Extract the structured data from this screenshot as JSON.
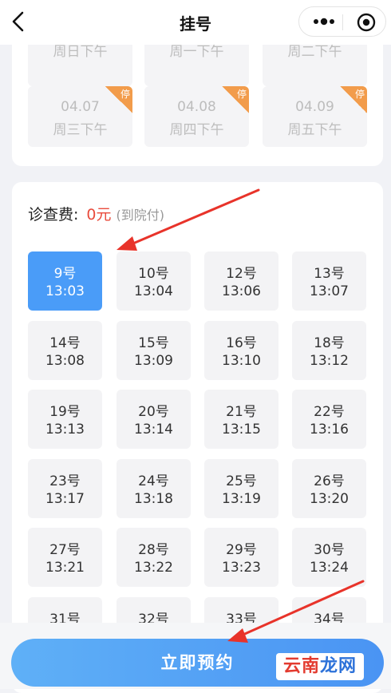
{
  "header": {
    "title": "挂号"
  },
  "dates": [
    {
      "date": "",
      "label": "周日下午",
      "stopped": false
    },
    {
      "date": "",
      "label": "周一下午",
      "stopped": false
    },
    {
      "date": "",
      "label": "周二下午",
      "stopped": false
    },
    {
      "date": "04.07",
      "label": "周三下午",
      "stopped": true
    },
    {
      "date": "04.08",
      "label": "周四下午",
      "stopped": true
    },
    {
      "date": "04.09",
      "label": "周五下午",
      "stopped": true
    }
  ],
  "stop_badge": "停",
  "fee": {
    "label": "诊查费:",
    "amount": "0元",
    "note": "(到院付)"
  },
  "slots": [
    {
      "num": "9号",
      "time": "13:03",
      "active": true
    },
    {
      "num": "10号",
      "time": "13:04"
    },
    {
      "num": "12号",
      "time": "13:06"
    },
    {
      "num": "13号",
      "time": "13:07"
    },
    {
      "num": "14号",
      "time": "13:08"
    },
    {
      "num": "15号",
      "time": "13:09"
    },
    {
      "num": "16号",
      "time": "13:10"
    },
    {
      "num": "18号",
      "time": "13:12"
    },
    {
      "num": "19号",
      "time": "13:13"
    },
    {
      "num": "20号",
      "time": "13:14"
    },
    {
      "num": "21号",
      "time": "13:15"
    },
    {
      "num": "22号",
      "time": "13:16"
    },
    {
      "num": "23号",
      "time": "13:17"
    },
    {
      "num": "24号",
      "time": "13:18"
    },
    {
      "num": "25号",
      "time": "13:19"
    },
    {
      "num": "26号",
      "time": "13:20"
    },
    {
      "num": "27号",
      "time": "13:21"
    },
    {
      "num": "28号",
      "time": "13:22"
    },
    {
      "num": "29号",
      "time": "13:23"
    },
    {
      "num": "30号",
      "time": "13:24"
    },
    {
      "num": "31号",
      "time": ""
    },
    {
      "num": "32号",
      "time": ""
    },
    {
      "num": "33号",
      "time": ""
    },
    {
      "num": "34号",
      "time": ""
    }
  ],
  "book_button": "立即预约",
  "watermark": {
    "part1": "云南",
    "part2": "龙网"
  },
  "colors": {
    "accent": "#4a9cf8",
    "fee": "#e94b3c",
    "stop": "#f29c4b",
    "arrow": "#e8332a"
  }
}
